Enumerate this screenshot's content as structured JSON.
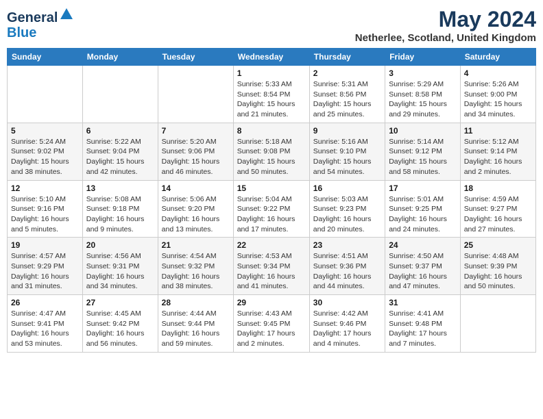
{
  "header": {
    "logo_general": "General",
    "logo_blue": "Blue",
    "month_title": "May 2024",
    "location": "Netherlee, Scotland, United Kingdom"
  },
  "days_of_week": [
    "Sunday",
    "Monday",
    "Tuesday",
    "Wednesday",
    "Thursday",
    "Friday",
    "Saturday"
  ],
  "weeks": [
    [
      {
        "day": "",
        "detail": ""
      },
      {
        "day": "",
        "detail": ""
      },
      {
        "day": "",
        "detail": ""
      },
      {
        "day": "1",
        "detail": "Sunrise: 5:33 AM\nSunset: 8:54 PM\nDaylight: 15 hours\nand 21 minutes."
      },
      {
        "day": "2",
        "detail": "Sunrise: 5:31 AM\nSunset: 8:56 PM\nDaylight: 15 hours\nand 25 minutes."
      },
      {
        "day": "3",
        "detail": "Sunrise: 5:29 AM\nSunset: 8:58 PM\nDaylight: 15 hours\nand 29 minutes."
      },
      {
        "day": "4",
        "detail": "Sunrise: 5:26 AM\nSunset: 9:00 PM\nDaylight: 15 hours\nand 34 minutes."
      }
    ],
    [
      {
        "day": "5",
        "detail": "Sunrise: 5:24 AM\nSunset: 9:02 PM\nDaylight: 15 hours\nand 38 minutes."
      },
      {
        "day": "6",
        "detail": "Sunrise: 5:22 AM\nSunset: 9:04 PM\nDaylight: 15 hours\nand 42 minutes."
      },
      {
        "day": "7",
        "detail": "Sunrise: 5:20 AM\nSunset: 9:06 PM\nDaylight: 15 hours\nand 46 minutes."
      },
      {
        "day": "8",
        "detail": "Sunrise: 5:18 AM\nSunset: 9:08 PM\nDaylight: 15 hours\nand 50 minutes."
      },
      {
        "day": "9",
        "detail": "Sunrise: 5:16 AM\nSunset: 9:10 PM\nDaylight: 15 hours\nand 54 minutes."
      },
      {
        "day": "10",
        "detail": "Sunrise: 5:14 AM\nSunset: 9:12 PM\nDaylight: 15 hours\nand 58 minutes."
      },
      {
        "day": "11",
        "detail": "Sunrise: 5:12 AM\nSunset: 9:14 PM\nDaylight: 16 hours\nand 2 minutes."
      }
    ],
    [
      {
        "day": "12",
        "detail": "Sunrise: 5:10 AM\nSunset: 9:16 PM\nDaylight: 16 hours\nand 5 minutes."
      },
      {
        "day": "13",
        "detail": "Sunrise: 5:08 AM\nSunset: 9:18 PM\nDaylight: 16 hours\nand 9 minutes."
      },
      {
        "day": "14",
        "detail": "Sunrise: 5:06 AM\nSunset: 9:20 PM\nDaylight: 16 hours\nand 13 minutes."
      },
      {
        "day": "15",
        "detail": "Sunrise: 5:04 AM\nSunset: 9:22 PM\nDaylight: 16 hours\nand 17 minutes."
      },
      {
        "day": "16",
        "detail": "Sunrise: 5:03 AM\nSunset: 9:23 PM\nDaylight: 16 hours\nand 20 minutes."
      },
      {
        "day": "17",
        "detail": "Sunrise: 5:01 AM\nSunset: 9:25 PM\nDaylight: 16 hours\nand 24 minutes."
      },
      {
        "day": "18",
        "detail": "Sunrise: 4:59 AM\nSunset: 9:27 PM\nDaylight: 16 hours\nand 27 minutes."
      }
    ],
    [
      {
        "day": "19",
        "detail": "Sunrise: 4:57 AM\nSunset: 9:29 PM\nDaylight: 16 hours\nand 31 minutes."
      },
      {
        "day": "20",
        "detail": "Sunrise: 4:56 AM\nSunset: 9:31 PM\nDaylight: 16 hours\nand 34 minutes."
      },
      {
        "day": "21",
        "detail": "Sunrise: 4:54 AM\nSunset: 9:32 PM\nDaylight: 16 hours\nand 38 minutes."
      },
      {
        "day": "22",
        "detail": "Sunrise: 4:53 AM\nSunset: 9:34 PM\nDaylight: 16 hours\nand 41 minutes."
      },
      {
        "day": "23",
        "detail": "Sunrise: 4:51 AM\nSunset: 9:36 PM\nDaylight: 16 hours\nand 44 minutes."
      },
      {
        "day": "24",
        "detail": "Sunrise: 4:50 AM\nSunset: 9:37 PM\nDaylight: 16 hours\nand 47 minutes."
      },
      {
        "day": "25",
        "detail": "Sunrise: 4:48 AM\nSunset: 9:39 PM\nDaylight: 16 hours\nand 50 minutes."
      }
    ],
    [
      {
        "day": "26",
        "detail": "Sunrise: 4:47 AM\nSunset: 9:41 PM\nDaylight: 16 hours\nand 53 minutes."
      },
      {
        "day": "27",
        "detail": "Sunrise: 4:45 AM\nSunset: 9:42 PM\nDaylight: 16 hours\nand 56 minutes."
      },
      {
        "day": "28",
        "detail": "Sunrise: 4:44 AM\nSunset: 9:44 PM\nDaylight: 16 hours\nand 59 minutes."
      },
      {
        "day": "29",
        "detail": "Sunrise: 4:43 AM\nSunset: 9:45 PM\nDaylight: 17 hours\nand 2 minutes."
      },
      {
        "day": "30",
        "detail": "Sunrise: 4:42 AM\nSunset: 9:46 PM\nDaylight: 17 hours\nand 4 minutes."
      },
      {
        "day": "31",
        "detail": "Sunrise: 4:41 AM\nSunset: 9:48 PM\nDaylight: 17 hours\nand 7 minutes."
      },
      {
        "day": "",
        "detail": ""
      }
    ]
  ]
}
